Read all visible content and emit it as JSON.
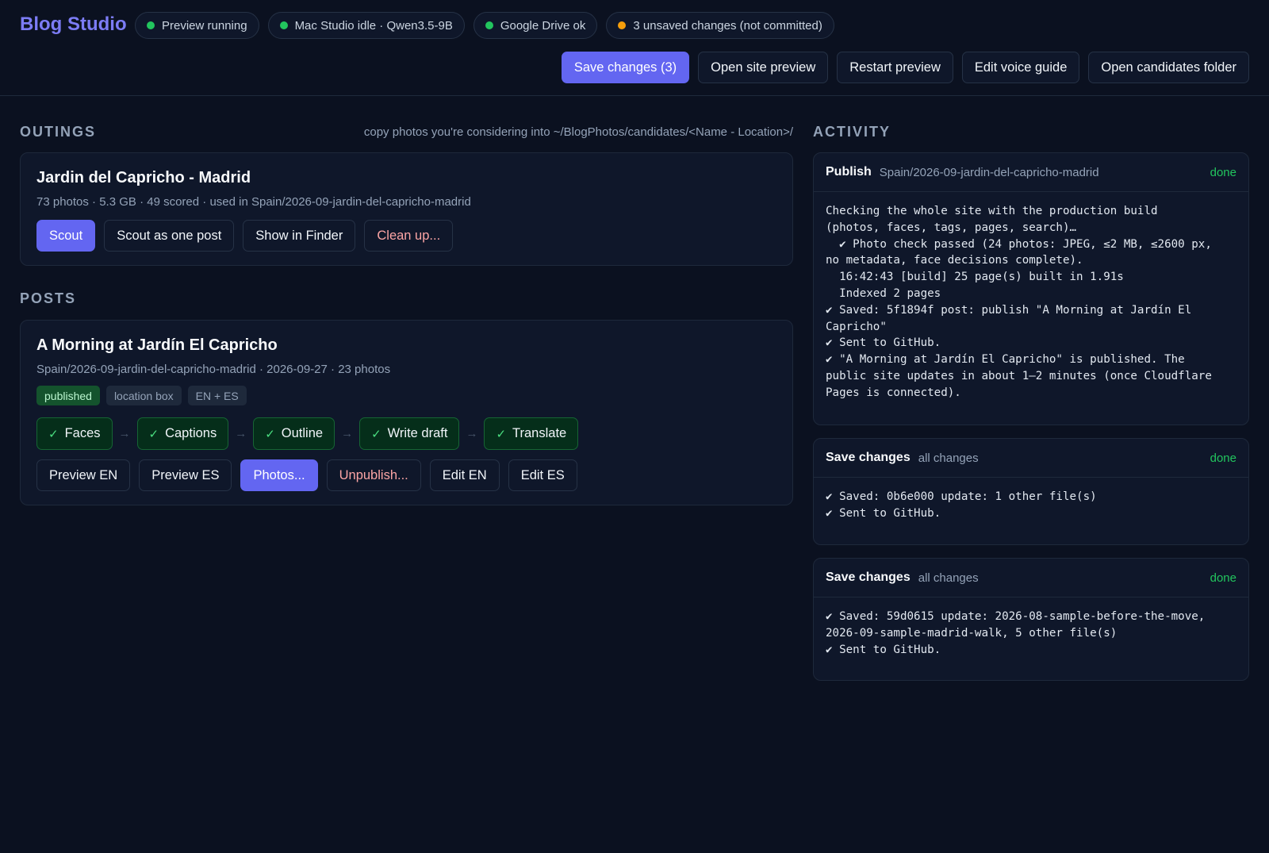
{
  "app": {
    "title": "Blog Studio"
  },
  "status_pills": [
    {
      "label": "Preview running",
      "color": "#22c55e"
    },
    {
      "label": "Mac Studio idle · Qwen3.5-9B",
      "color": "#22c55e"
    },
    {
      "label": "Google Drive ok",
      "color": "#22c55e"
    },
    {
      "label": "3 unsaved changes (not committed)",
      "color": "#f59e0b"
    }
  ],
  "toolbar": {
    "save": "Save changes (3)",
    "open_preview": "Open site preview",
    "restart_preview": "Restart preview",
    "edit_voice": "Edit voice guide",
    "open_candidates": "Open candidates folder"
  },
  "outings": {
    "heading": "OUTINGS",
    "hint": "copy photos you're considering into ~/BlogPhotos/candidates/<Name - Location>/",
    "items": [
      {
        "title": "Jardin del Capricho - Madrid",
        "meta": "73 photos · 5.3 GB · 49 scored · used in Spain/2026-09-jardin-del-capricho-madrid",
        "buttons": {
          "scout": "Scout",
          "scout_one": "Scout as one post",
          "show_finder": "Show in Finder",
          "clean_up": "Clean up..."
        }
      }
    ]
  },
  "posts": {
    "heading": "POSTS",
    "items": [
      {
        "title": "A Morning at Jardín El Capricho",
        "meta": "Spain/2026-09-jardin-del-capricho-madrid · 2026-09-27 · 23 photos",
        "tags": [
          "published",
          "location box",
          "EN + ES"
        ],
        "steps": [
          "Faces",
          "Captions",
          "Outline",
          "Write draft",
          "Translate"
        ],
        "buttons": {
          "preview_en": "Preview EN",
          "preview_es": "Preview ES",
          "photos": "Photos...",
          "unpublish": "Unpublish...",
          "edit_en": "Edit EN",
          "edit_es": "Edit ES"
        }
      }
    ]
  },
  "activity": {
    "heading": "ACTIVITY",
    "items": [
      {
        "name": "Publish",
        "sub": "Spain/2026-09-jardin-del-capricho-madrid",
        "status": "done",
        "log": "Checking the whole site with the production build\n(photos, faces, tags, pages, search)…\n  ✔ Photo check passed (24 photos: JPEG, ≤2 MB, ≤2600 px,\nno metadata, face decisions complete).\n  16:42:43 [build] 25 page(s) built in 1.91s\n  Indexed 2 pages\n✔ Saved: 5f1894f post: publish \"A Morning at Jardín El\nCapricho\"\n✔ Sent to GitHub.\n✔ \"A Morning at Jardín El Capricho\" is published. The\npublic site updates in about 1–2 minutes (once Cloudflare\nPages is connected)."
      },
      {
        "name": "Save changes",
        "sub": "all changes",
        "status": "done",
        "log": "✔ Saved: 0b6e000 update: 1 other file(s)\n✔ Sent to GitHub."
      },
      {
        "name": "Save changes",
        "sub": "all changes",
        "status": "done",
        "log": "✔ Saved: 59d0615 update: 2026-08-sample-before-the-move,\n2026-09-sample-madrid-walk, 5 other file(s)\n✔ Sent to GitHub."
      }
    ]
  }
}
